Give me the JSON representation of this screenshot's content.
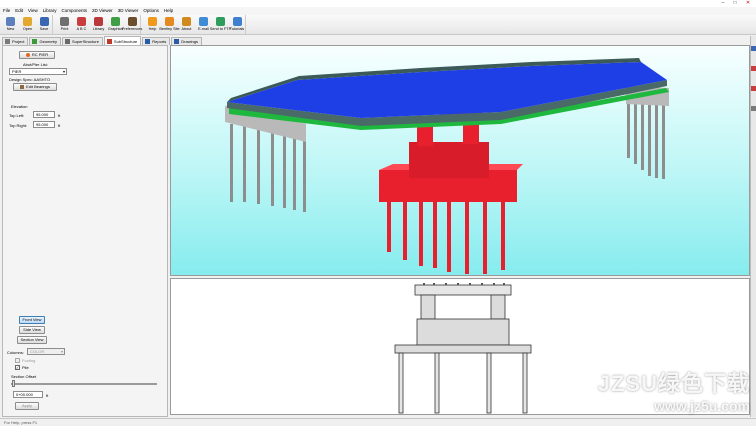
{
  "window": {
    "controls": [
      "–",
      "□",
      "✕"
    ]
  },
  "menu": [
    "File",
    "Edit",
    "View",
    "Library",
    "Components",
    "2D Viewer",
    "3D Viewer",
    "Options",
    "Help"
  ],
  "toolbar": [
    {
      "label": "New",
      "icon": "new-icon",
      "color": "#5b7fbf"
    },
    {
      "label": "Open",
      "icon": "open-icon",
      "color": "#e2a92e"
    },
    {
      "label": "Save",
      "icon": "save-icon",
      "color": "#3a66b4"
    },
    {
      "label": "Print",
      "icon": "print-icon",
      "color": "#707070"
    },
    {
      "label": "A B C",
      "icon": "abc-icon",
      "color": "#c83e3e"
    },
    {
      "label": "Library",
      "icon": "library-icon",
      "color": "#b9383a"
    },
    {
      "label": "Graphics",
      "icon": "graphics-icon",
      "color": "#3f9e46"
    },
    {
      "label": "Preferences",
      "icon": "preferences-icon",
      "color": "#6b4f2c"
    },
    {
      "label": "Help",
      "icon": "help-icon",
      "color": "#f09a1c"
    },
    {
      "label": "Bentley Site",
      "icon": "bentley-site-icon",
      "color": "#e48a20"
    },
    {
      "label": "About",
      "icon": "about-icon",
      "color": "#d08a1e"
    },
    {
      "label": "E-mail",
      "icon": "email-icon",
      "color": "#3e8bd6"
    },
    {
      "label": "Send to FTP",
      "icon": "send-to-ftp-icon",
      "color": "#2f9e5c"
    },
    {
      "label": "Tutorials",
      "icon": "tutorials-icon",
      "color": "#3e7fcf"
    }
  ],
  "tabs": [
    {
      "label": "Project",
      "icon": "project-icon",
      "color": "#7a7a7a"
    },
    {
      "label": "Geometry",
      "icon": "geometry-icon",
      "color": "#3c9a3c"
    },
    {
      "label": "SuperStructure",
      "icon": "superstructure-icon",
      "color": "#6a6a6a"
    },
    {
      "label": "SubStructure",
      "icon": "substructure-icon",
      "color": "#c0392b",
      "active": true
    },
    {
      "label": "Reports",
      "icon": "reports-icon",
      "color": "#2a5ba8"
    },
    {
      "label": "Drawings",
      "icon": "drawings-icon",
      "color": "#2a5ba8"
    }
  ],
  "left_panel": {
    "rc_pier_button": "RC PIER",
    "abut_pier_list_label": "Abut/Pier List:",
    "abut_pier_selected": "PIER",
    "design_spec": "Design Spec: AASHTO",
    "edit_bearings_button": "Edit Bearings",
    "elevation_heading": "Elevation",
    "top_left_label": "Top Left:",
    "top_left_value": "95.000",
    "top_left_unit": "ft",
    "top_right_label": "Top Right:",
    "top_right_value": "95.000",
    "top_right_unit": "ft",
    "front_view_button": "Front View",
    "side_view_button": "Side View",
    "section_view_button": "Section View",
    "columns_label": "Columns:",
    "columns_value": "COLOR",
    "footing_label": "Footing",
    "pile_label": "Pile",
    "section_offset_label": "Section Offset",
    "section_offset_value": "0+00.000",
    "section_offset_unit": "ft",
    "apply_button": "Apply"
  },
  "colors": {
    "deck": "#1f3fe6",
    "girder": "#1fb83e",
    "pier": "#e8202e",
    "abutment": "#b9b9b9",
    "pile": "#8d8d8d",
    "sky": "#a6f2f2"
  },
  "status_text": "For Help, press F1",
  "watermark": {
    "main": "JZSU绿色下载",
    "url": "www.jz5u.com"
  }
}
